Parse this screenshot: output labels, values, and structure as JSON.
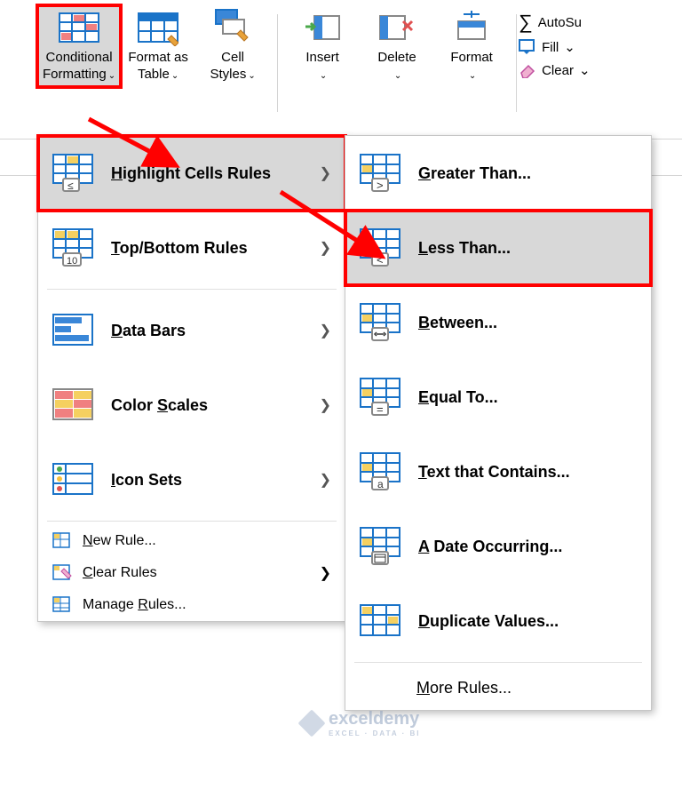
{
  "ribbon": {
    "cond_fmt": "Conditional\nFormatting",
    "fmt_table": "Format as\nTable",
    "cell_styles": "Cell\nStyles",
    "insert": "Insert",
    "delete": "Delete",
    "format": "Format",
    "autosum": "AutoSu",
    "fill": "Fill",
    "clear": "Clear"
  },
  "menu1": {
    "highlight": "Highlight Cells Rules",
    "topbottom": "Top/Bottom Rules",
    "databars": "Data Bars",
    "colorscales": "Color Scales",
    "iconsets": "Icon Sets",
    "newrule": "New Rule...",
    "clearrules": "Clear Rules",
    "manage": "Manage Rules..."
  },
  "menu2": {
    "greater": "Greater Than...",
    "less": "Less Than...",
    "between": "Between...",
    "equal": "Equal To...",
    "textcontains": "Text that Contains...",
    "dateoccur": "A Date Occurring...",
    "duplicate": "Duplicate Values...",
    "more": "More Rules..."
  },
  "watermark": {
    "name": "exceldemy",
    "tag": "EXCEL · DATA · BI"
  }
}
